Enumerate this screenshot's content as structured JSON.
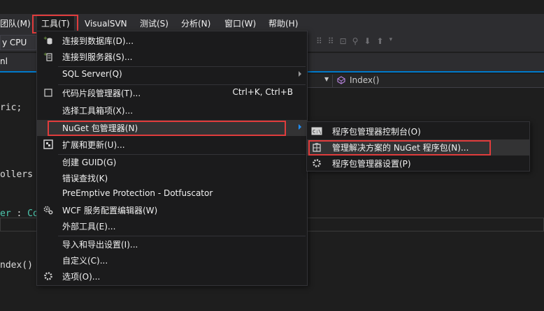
{
  "menubar": {
    "items": [
      "团队(M)",
      "工具(T)",
      "VisualSVN",
      "测试(S)",
      "分析(N)",
      "窗口(W)",
      "帮助(H)"
    ]
  },
  "toolbar": {
    "cpu_fragment": "y CPU"
  },
  "tabs": {
    "fragment": "nl"
  },
  "navbar": {
    "method": "Index()"
  },
  "code": {
    "lines": [
      "ric;",
      "ollers",
      "er",
      " : ",
      "Con",
      "ndex()"
    ]
  },
  "tools_menu": {
    "items": [
      {
        "label": "连接到数据库(D)...",
        "icon": "database-connect-icon"
      },
      {
        "label": "连接到服务器(S)...",
        "icon": "server-connect-icon"
      },
      {
        "label": "SQL Server(Q)"
      },
      {
        "label": "代码片段管理器(T)...",
        "shortcut": "Ctrl+K, Ctrl+B",
        "icon": "checkbox-icon"
      },
      {
        "label": "选择工具箱项(X)..."
      },
      {
        "label": "NuGet 包管理器(N)"
      },
      {
        "label": "扩展和更新(U)...",
        "icon": "extensions-icon"
      },
      {
        "label": "创建 GUID(G)"
      },
      {
        "label": "错误查找(K)"
      },
      {
        "label": "PreEmptive Protection - Dotfuscator"
      },
      {
        "label": "WCF 服务配置编辑器(W)",
        "icon": "wcf-gears-icon"
      },
      {
        "label": "外部工具(E)..."
      },
      {
        "label": "导入和导出设置(I)..."
      },
      {
        "label": "自定义(C)..."
      },
      {
        "label": "选项(O)...",
        "icon": "gear-icon"
      }
    ]
  },
  "nuget_submenu": {
    "items": [
      {
        "label": "程序包管理器控制台(O)",
        "icon": "console-icon"
      },
      {
        "label": "管理解决方案的 NuGet 程序包(N)...",
        "icon": "package-icon"
      },
      {
        "label": "程序包管理器设置(P)",
        "icon": "gear-icon"
      }
    ]
  },
  "colors": {
    "background": "#1e1e1e",
    "menu_bg": "#1b1b1c",
    "accent": "#007acc",
    "highlight_box": "#e03c3c"
  }
}
